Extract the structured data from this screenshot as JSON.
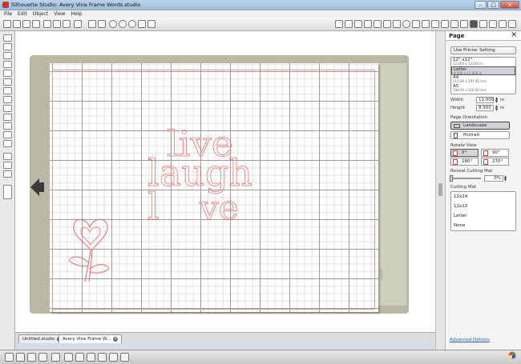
{
  "window": {
    "title": "Silhouette Studio: Avery Vine Frame Words.studio"
  },
  "menu": [
    "File",
    "Edit",
    "Object",
    "View",
    "Help"
  ],
  "canvas": {
    "design_words": [
      "live",
      "laugh",
      "l",
      "ve"
    ],
    "mat_label": "Letter"
  },
  "tabs": [
    {
      "label": "Untitled.studio",
      "active": false
    },
    {
      "label": "Avery Vine Frame W...",
      "active": true
    }
  ],
  "page_panel": {
    "title": "Page",
    "use_printer_setting": "Use Printer Setting",
    "sizes": [
      {
        "name": "12\" x12\"",
        "dims": "12.000 x 12.000 in",
        "selected": false
      },
      {
        "name": "Letter",
        "dims": "8.500 x 11.000 in",
        "selected": true
      },
      {
        "name": "A4",
        "dims": "210.00 x 297.00 mm",
        "selected": false
      },
      {
        "name": "A5",
        "dims": "148.00 x 210.00 mm",
        "selected": false
      }
    ],
    "width_label": "Width",
    "width_value": "11.000",
    "height_label": "Height",
    "height_value": "8.500",
    "unit": "in",
    "orientation_label": "Page Orientation",
    "orientation_landscape": "Landscape",
    "orientation_portrait": "Portrait",
    "rotate_label": "Rotate View",
    "rotate_0": "0°",
    "rotate_90": "90°",
    "rotate_180": "180°",
    "rotate_270": "270°",
    "reveal_label": "Reveal Cutting Mat",
    "reveal_value": "0%",
    "reveal_fraction": 0,
    "cutting_mat_label": "Cutting Mat",
    "cutting_mats": [
      "12x24",
      "12x12",
      "Letter",
      "None"
    ],
    "advanced_options": "Advanced Options"
  },
  "colors": {
    "cut_line": "#e86a6a",
    "mat": "#b9b9a4",
    "link": "#2a5db0"
  }
}
